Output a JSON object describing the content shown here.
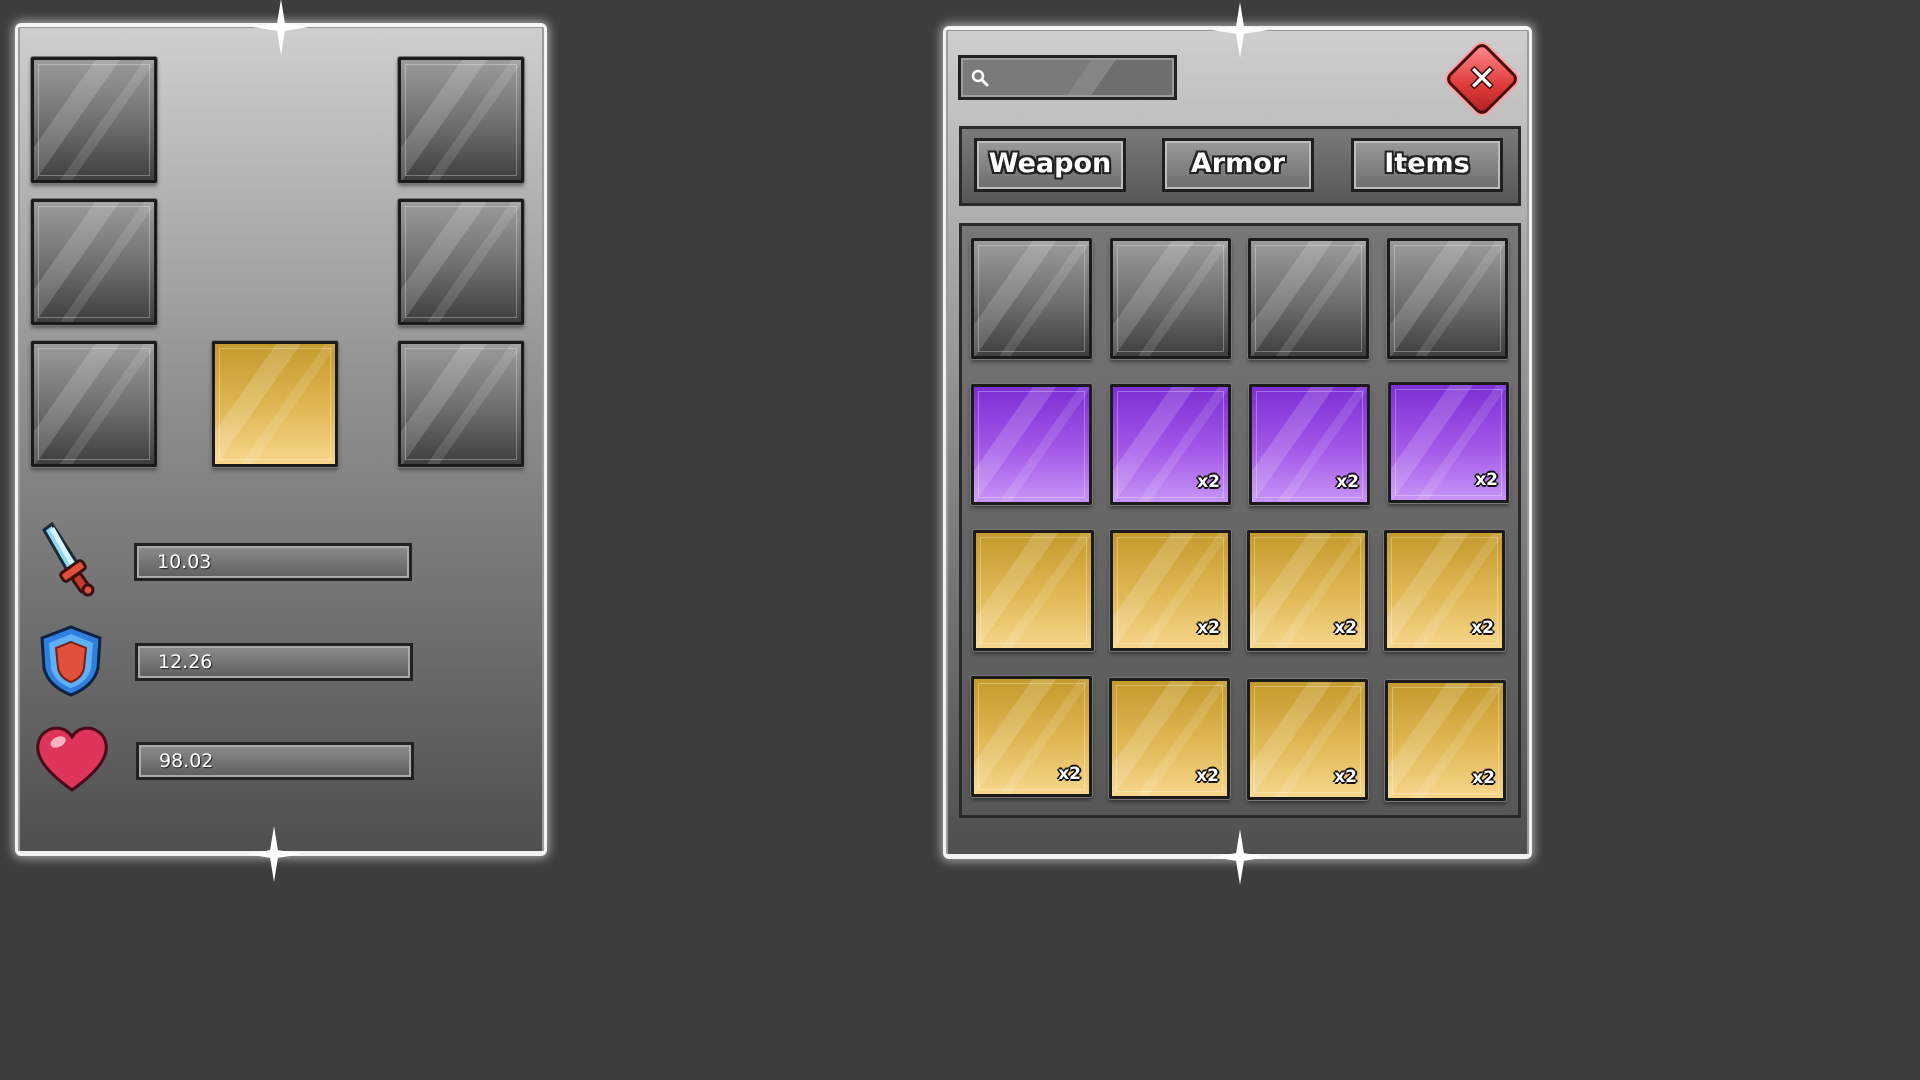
{
  "equipment": {
    "slots": [
      {
        "rarity": "gray"
      },
      {
        "rarity": "gray"
      },
      {
        "rarity": "gray"
      },
      {
        "rarity": "gray"
      },
      {
        "rarity": "gray"
      },
      {
        "rarity": "gold"
      },
      {
        "rarity": "gray"
      }
    ]
  },
  "stats": {
    "attack": {
      "icon": "sword-icon",
      "value": "10.03"
    },
    "defense": {
      "icon": "shield-icon",
      "value": "12.26"
    },
    "health": {
      "icon": "heart-icon",
      "value": "98.02"
    }
  },
  "inventory": {
    "search": {
      "placeholder": "",
      "value": ""
    },
    "close_icon": "close-icon",
    "tabs": [
      {
        "label": "Weapon"
      },
      {
        "label": "Armor"
      },
      {
        "label": "Items"
      }
    ],
    "items": [
      {
        "rarity": "gray",
        "qty": ""
      },
      {
        "rarity": "gray",
        "qty": ""
      },
      {
        "rarity": "gray",
        "qty": ""
      },
      {
        "rarity": "gray",
        "qty": ""
      },
      {
        "rarity": "purple",
        "qty": ""
      },
      {
        "rarity": "purple",
        "qty": "x2"
      },
      {
        "rarity": "purple",
        "qty": "x2"
      },
      {
        "rarity": "purple",
        "qty": "x2"
      },
      {
        "rarity": "gold",
        "qty": ""
      },
      {
        "rarity": "gold",
        "qty": "x2"
      },
      {
        "rarity": "gold",
        "qty": "x2"
      },
      {
        "rarity": "gold",
        "qty": "x2"
      },
      {
        "rarity": "gold",
        "qty": "x2"
      },
      {
        "rarity": "gold",
        "qty": "x2"
      },
      {
        "rarity": "gold",
        "qty": "x2"
      },
      {
        "rarity": "gold",
        "qty": "x2"
      }
    ]
  },
  "colors": {
    "background": "#3d3d3d",
    "gray_slot": "#6d6d6d",
    "purple_slot": "#a458e8",
    "gold_slot": "#e0b855",
    "close_button": "#e03a3a"
  }
}
